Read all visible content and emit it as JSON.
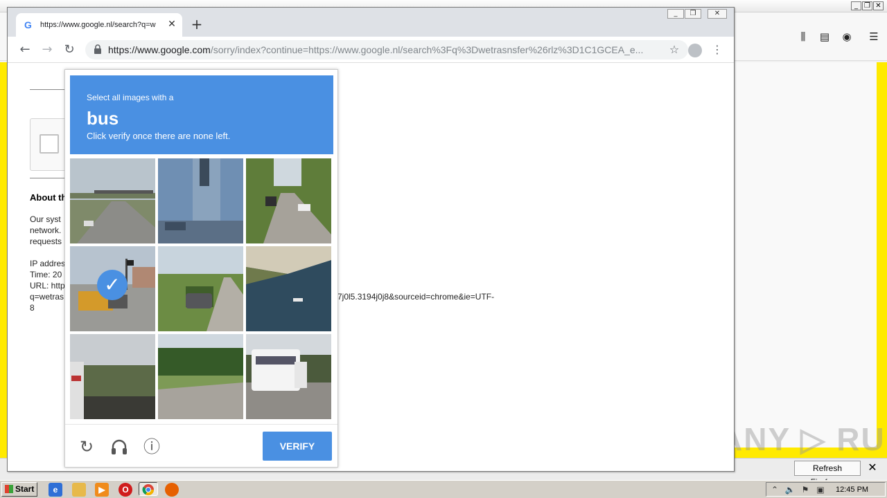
{
  "firefox": {
    "refresh_label": "Refresh Firefox…",
    "notification_close": "✕"
  },
  "chrome": {
    "tab_title": "https://www.google.nl/search?q=w",
    "tab_close": "✕",
    "new_tab": "+",
    "url_host": "https://www.google.com",
    "url_rest": "/sorry/index?continue=https://www.google.nl/search%3Fq%3Dwetrasnsfer%26rlz%3D1C1GCEA_e..."
  },
  "page": {
    "about_heading": "About th",
    "lines": [
      "Our syst",
      "network.",
      "requests",
      "IP addres",
      "Time: 20",
      "URL: http",
      "q=wetras",
      "8"
    ],
    "url_tail": "7j0l5.3194j0j8&sourceid=chrome&ie=UTF-"
  },
  "captcha": {
    "prompt": "Select all images with a",
    "object": "bus",
    "instruction": "Click verify once there are none left.",
    "verify_label": "VERIFY",
    "selected_tiles": [
      3
    ]
  },
  "watermark": "ANY ▷ RUN",
  "taskbar": {
    "start_label": "Start",
    "clock": "12:45 PM"
  }
}
